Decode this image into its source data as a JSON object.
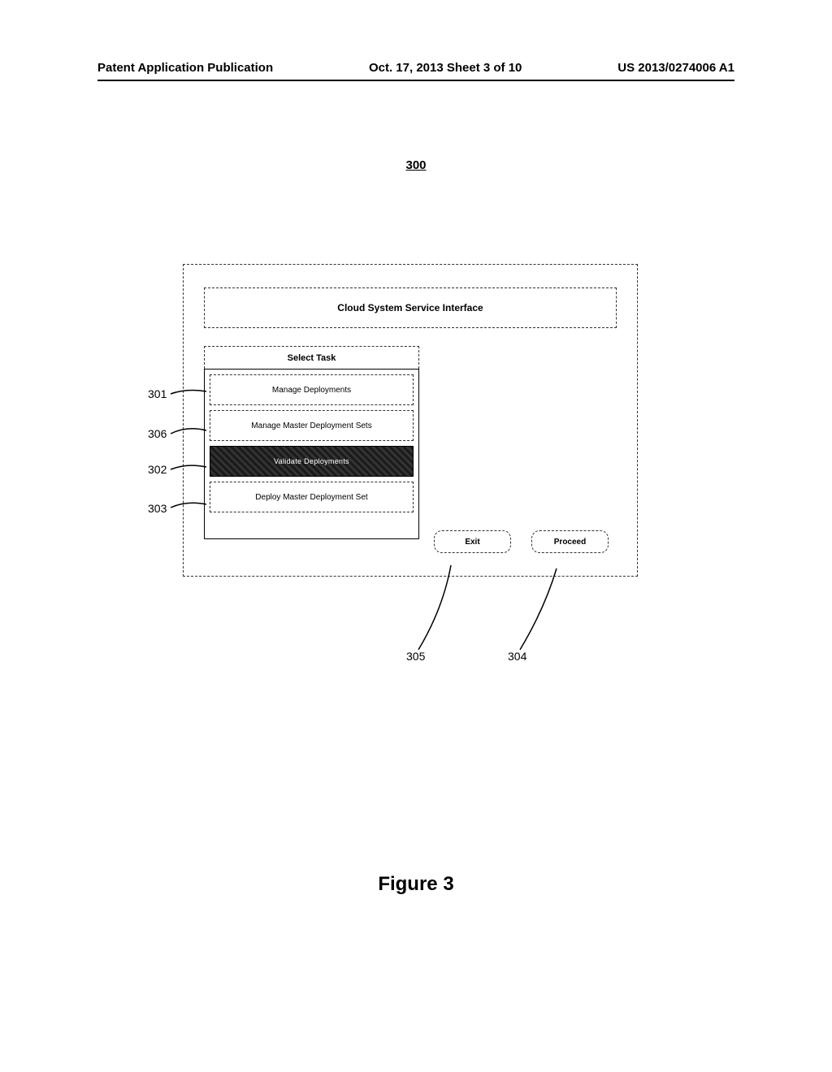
{
  "header": {
    "left": "Patent Application Publication",
    "center": "Oct. 17, 2013  Sheet 3 of 10",
    "right": "US 2013/0274006 A1"
  },
  "figure": {
    "ref_main": "300",
    "caption": "Figure 3",
    "dialog": {
      "title": "Cloud System Service Interface",
      "panel_header": "Select Task",
      "items": [
        {
          "label": "Manage Deployments",
          "selected": false
        },
        {
          "label": "Manage Master Deployment Sets",
          "selected": false
        },
        {
          "label": "Validate Deployments",
          "selected": true
        },
        {
          "label": "Deploy Master Deployment Set",
          "selected": false
        }
      ],
      "buttons": {
        "exit": "Exit",
        "proceed": "Proceed"
      }
    },
    "callouts": {
      "ref_301": "301",
      "ref_306": "306",
      "ref_302": "302",
      "ref_303": "303",
      "ref_305": "305",
      "ref_304": "304"
    }
  }
}
